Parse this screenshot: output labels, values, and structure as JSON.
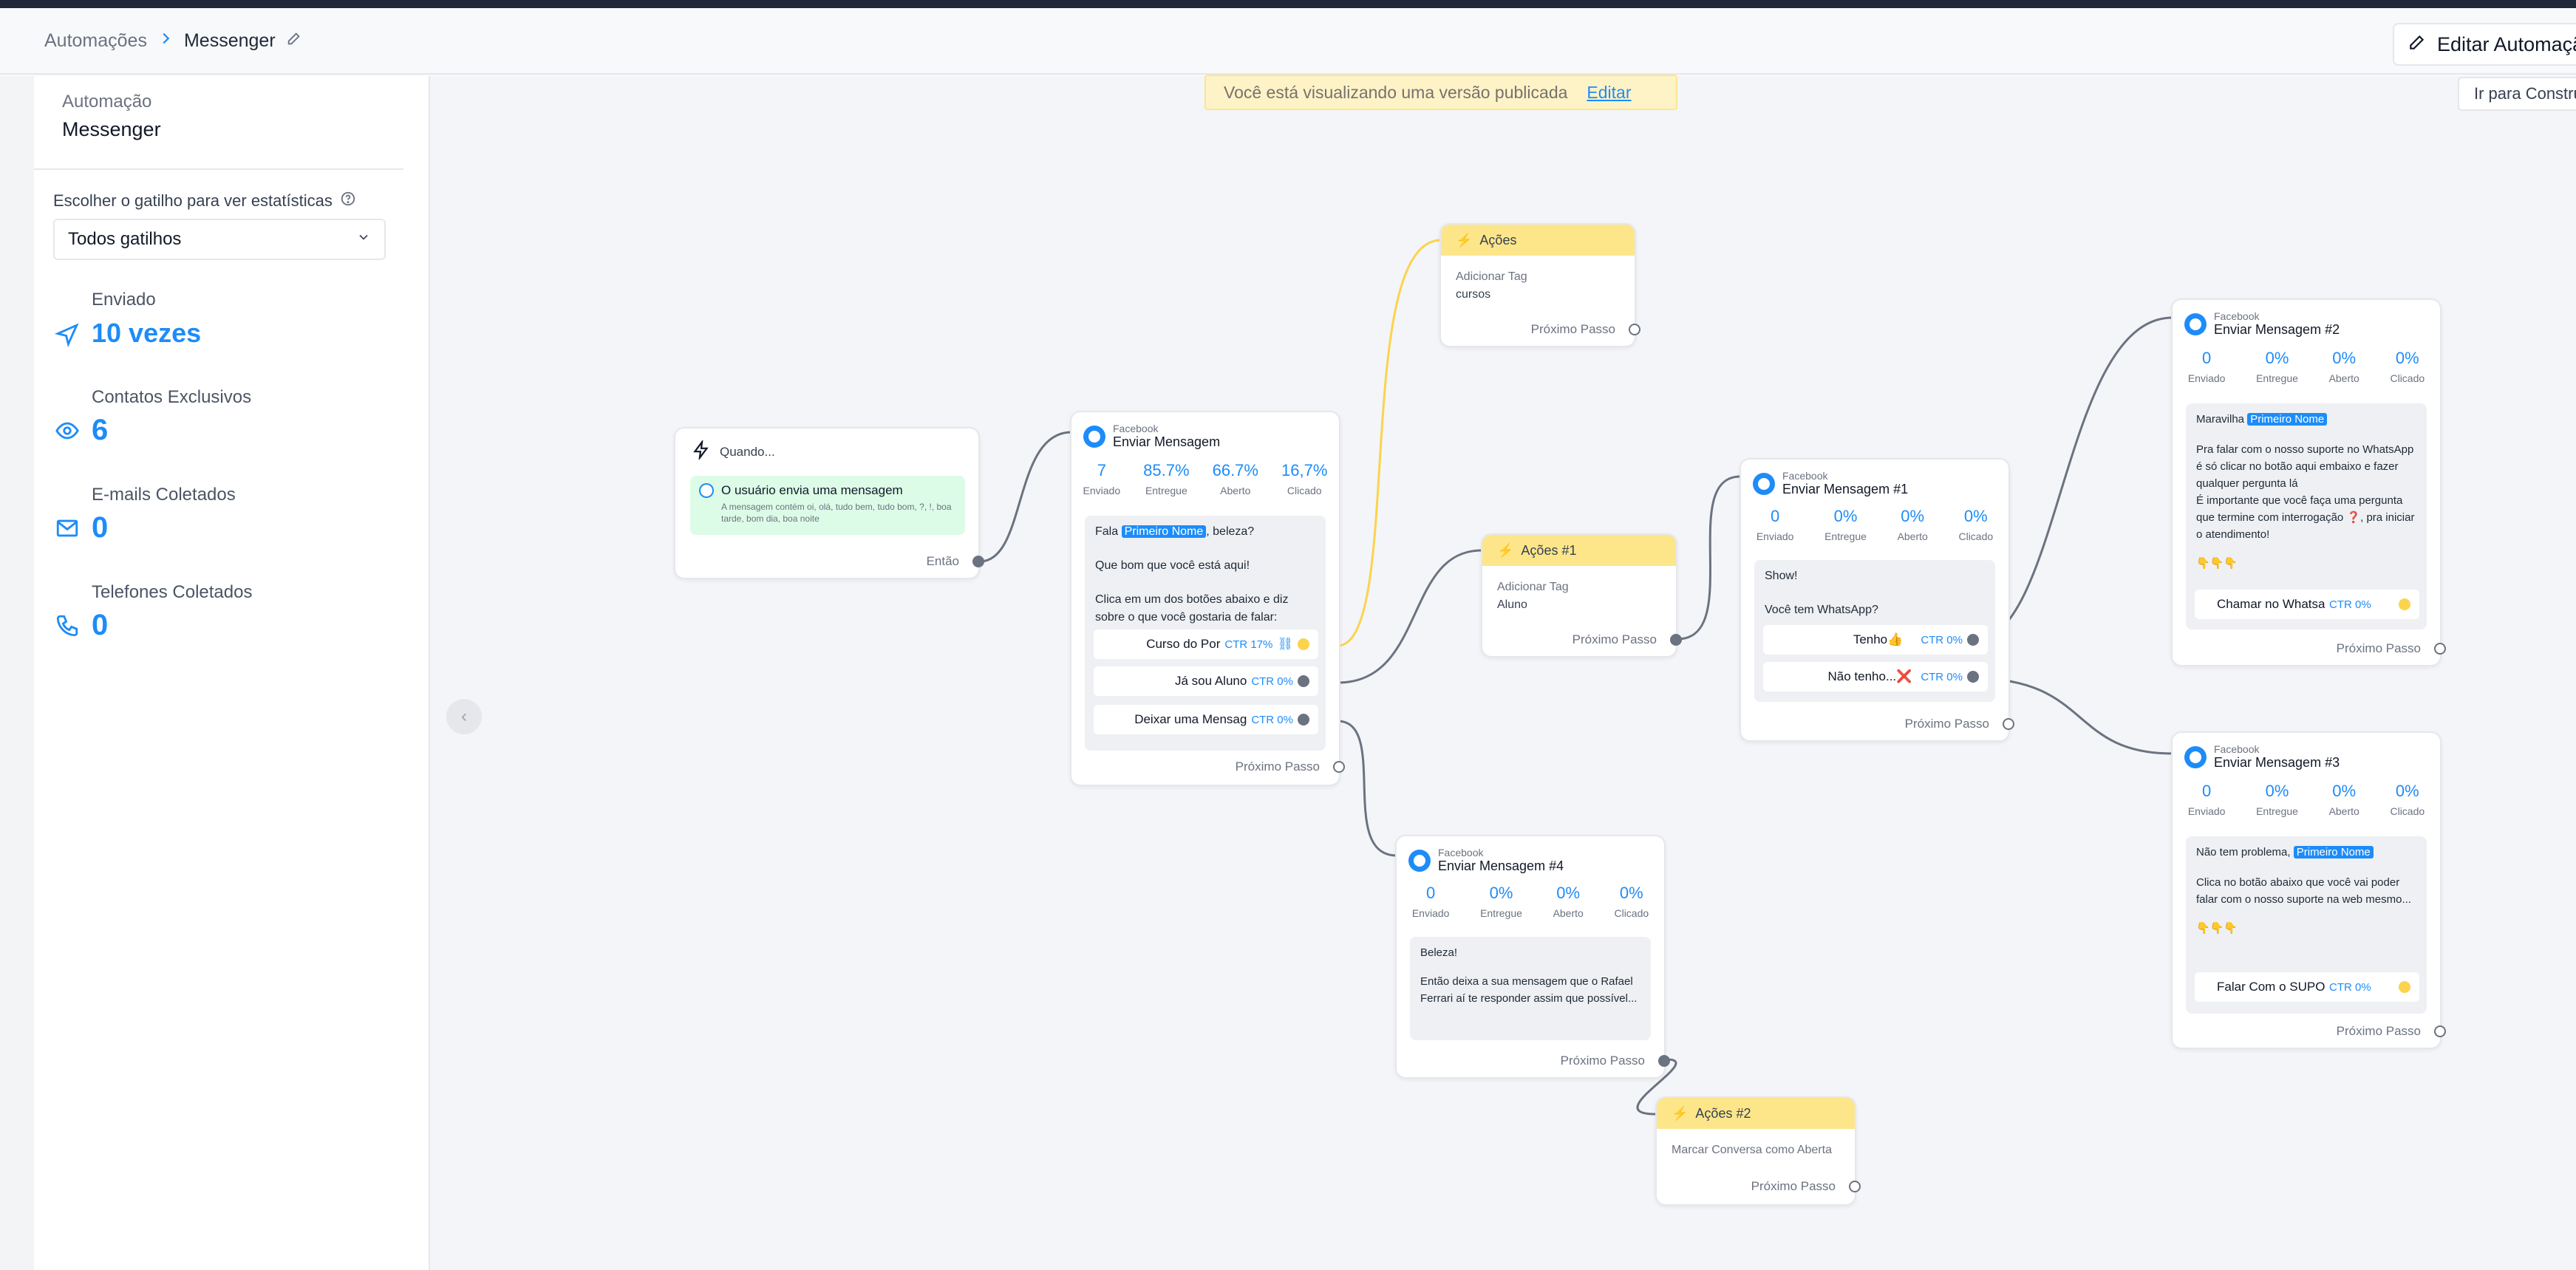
{
  "header": {
    "breadcrumb_root": "Automações",
    "breadcrumb_current": "Messenger",
    "edit_button": "Editar Automação"
  },
  "sidebar": {
    "automation_label": "Automação",
    "automation_name": "Messenger",
    "trigger_label": "Escolher o gatilho para ver estatísticas",
    "trigger_select": "Todos gatilhos",
    "stats": [
      {
        "label": "Enviado",
        "value": "10 vezes",
        "icon": "send-icon"
      },
      {
        "label": "Contatos Exclusivos",
        "value": "6",
        "icon": "eye-icon"
      },
      {
        "label": "E-mails Coletados",
        "value": "0",
        "icon": "mail-icon"
      },
      {
        "label": "Telefones Coletados",
        "value": "0",
        "icon": "phone-icon"
      }
    ]
  },
  "canvas": {
    "banner_text": "Você está visualizando uma versão publicada",
    "banner_link": "Editar",
    "goto_button": "Ir para Construtor",
    "collapse": "‹"
  },
  "common": {
    "facebook": "Facebook",
    "proximo": "Próximo Passo",
    "stat_labels": [
      "Enviado",
      "Entregue",
      "Aberto",
      "Clicado"
    ],
    "add_tag": "Adicionar Tag",
    "first_name": "Primeiro Nome"
  },
  "trigger": {
    "title": "Quando...",
    "event": "O usuário envia uma mensagem",
    "keywords": "A mensagem contém oi, olá, tudo bem, tudo bom, ?, !, boa tarde, bom dia, boa noite",
    "then": "Então"
  },
  "msg_main": {
    "title": "Enviar Mensagem",
    "stats": [
      "7",
      "85.7%",
      "66.7%",
      "16,7%"
    ],
    "greeting_pre": "Fala",
    "greeting_post": ", beleza?",
    "line2": "Que bom que você está aqui!",
    "line3": "Clica em um dos botões abaixo e diz sobre o que você gostaria de falar:",
    "buttons": [
      {
        "label": "Curso do Por",
        "ctr": "CTR 17%"
      },
      {
        "label": "Já sou Aluno",
        "ctr": "CTR 0%"
      },
      {
        "label": "Deixar uma Mensag",
        "ctr": "CTR 0%"
      }
    ]
  },
  "acoes": {
    "title": "Ações",
    "tag": "cursos"
  },
  "acoes1": {
    "title": "Ações #1",
    "tag": "Aluno"
  },
  "acoes2": {
    "title": "Ações #2",
    "action": "Marcar Conversa como Aberta"
  },
  "msg1": {
    "title": "Enviar Mensagem #1",
    "stats": [
      "0",
      "0%",
      "0%",
      "0%"
    ],
    "line1": "Show!",
    "line2": "Você tem WhatsApp?",
    "buttons": [
      {
        "label": "Tenho👍",
        "ctr": "CTR 0%"
      },
      {
        "label": "Não tenho...❌",
        "ctr": "CTR 0%"
      }
    ]
  },
  "msg2": {
    "title": "Enviar Mensagem #2",
    "stats": [
      "0",
      "0%",
      "0%",
      "0%"
    ],
    "greeting_pre": "Maravilha",
    "text": "Pra falar com o nosso suporte no WhatsApp é só clicar no botão aqui embaixo e fazer qualquer pergunta lá",
    "text2": "É importante que você faça uma pergunta que termine com interrogação ❓, pra iniciar o atendimento!",
    "emoji": "👇👇👇",
    "button": {
      "label": "Chamar no Whatsa",
      "ctr": "CTR 0%"
    }
  },
  "msg3": {
    "title": "Enviar Mensagem #3",
    "stats": [
      "0",
      "0%",
      "0%",
      "0%"
    ],
    "greeting_pre": "Não tem problema,",
    "text": "Clica no botão abaixo que você vai poder falar com o nosso suporte na web mesmo...",
    "emoji": "👇👇👇",
    "button": {
      "label": "Falar Com o SUPO",
      "ctr": "CTR 0%"
    }
  },
  "msg4": {
    "title": "Enviar Mensagem #4",
    "stats": [
      "0",
      "0%",
      "0%",
      "0%"
    ],
    "line1": "Beleza!",
    "text": "Então deixa a sua mensagem que o Rafael Ferrari aí te responder assim que possível..."
  },
  "colors": {
    "accent": "#1d8cf8",
    "actions": "#fde68a",
    "connector": "#6b7280",
    "connector_yellow": "#fcd34d"
  }
}
